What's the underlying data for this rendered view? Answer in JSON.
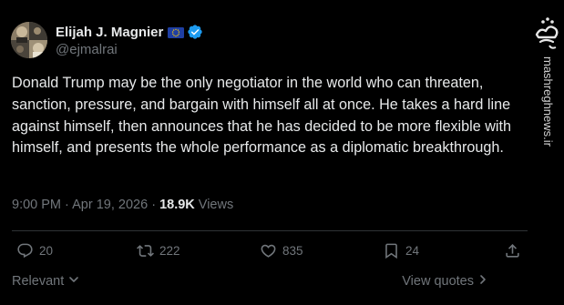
{
  "author": {
    "name": "Elijah J. Magnier",
    "handle": "@ejmalrai",
    "flag_icon": "eu-flag-icon",
    "verified_icon": "verified-badge-icon",
    "verified_color": "#1d9bf0"
  },
  "tweet": {
    "text": "Donald Trump may be the only negotiator in the world who can threaten, sanction, pressure, and bargain with himself all at once. He takes a hard line against himself, then announces that he has decided to be more flexible with himself, and presents the whole performance as a diplomatic breakthrough.",
    "time": "9:00 PM",
    "separator": "·",
    "date": "Apr 19, 2026",
    "views_count": "18.9K",
    "views_label": "Views"
  },
  "actions": {
    "reply": {
      "icon": "reply-icon",
      "count": "20"
    },
    "retweet": {
      "icon": "retweet-icon",
      "count": "222"
    },
    "like": {
      "icon": "heart-icon",
      "count": "835"
    },
    "bookmark": {
      "icon": "bookmark-icon",
      "count": "24"
    },
    "share": {
      "icon": "share-icon"
    }
  },
  "footer": {
    "sort_label": "Relevant",
    "view_quotes_label": "View quotes"
  },
  "watermark": {
    "logo_text": "مشرق",
    "url": "mashreghnews.ir"
  },
  "colors": {
    "background": "#000000",
    "text_primary": "#e7e9ea",
    "text_secondary": "#71767b",
    "divider": "#2f3336"
  }
}
